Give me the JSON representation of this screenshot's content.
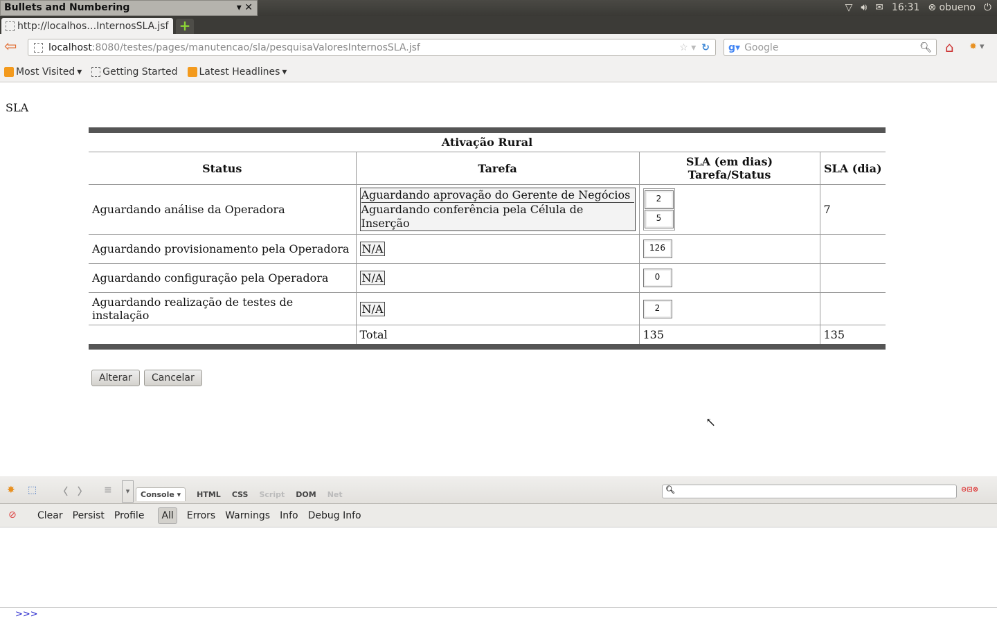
{
  "system": {
    "panel_title": "Bullets and Numbering",
    "time": "16:31",
    "user": "obueno"
  },
  "browser": {
    "tab_title": "http://localhos…InternosSLA.jsf",
    "url_host": "localhost",
    "url_rest": ":8080/testes/pages/manutencao/sla/pesquisaValoresInternosSLA.jsf",
    "search_placeholder": "Google",
    "bookmarks": [
      "Most Visited",
      "Getting Started",
      "Latest Headlines"
    ]
  },
  "page": {
    "title": "SLA",
    "table": {
      "caption": "Ativação Rural",
      "headers": [
        "Status",
        "Tarefa",
        "SLA (em dias) Tarefa/Status",
        "SLA (dia)"
      ],
      "rows": [
        {
          "status": "Aguardando análise da Operadora",
          "tarefas": [
            "Aguardando aprovação do Gerente de Negócios",
            "Aguardando conferência pela Célula de Inserção"
          ],
          "values": [
            "2",
            "5"
          ],
          "sla_dia": "7"
        },
        {
          "status": "Aguardando provisionamento pela Operadora",
          "tarefa": "N/A",
          "value": "126"
        },
        {
          "status": "Aguardando configuração pela Operadora",
          "tarefa": "N/A",
          "value": "0"
        },
        {
          "status": "Aguardando realização de testes de instalação",
          "tarefa": "N/A",
          "value": "2"
        }
      ],
      "total_label": "Total",
      "total_tarefa": "135",
      "total_dia": "135"
    },
    "buttons": {
      "alterar": "Alterar",
      "cancelar": "Cancelar"
    }
  },
  "firebug": {
    "tabs": [
      "Console",
      "HTML",
      "CSS",
      "Script",
      "DOM",
      "Net"
    ],
    "console_buttons": [
      "Clear",
      "Persist",
      "Profile",
      "All",
      "Errors",
      "Warnings",
      "Info",
      "Debug Info"
    ],
    "prompt": ">>>"
  }
}
